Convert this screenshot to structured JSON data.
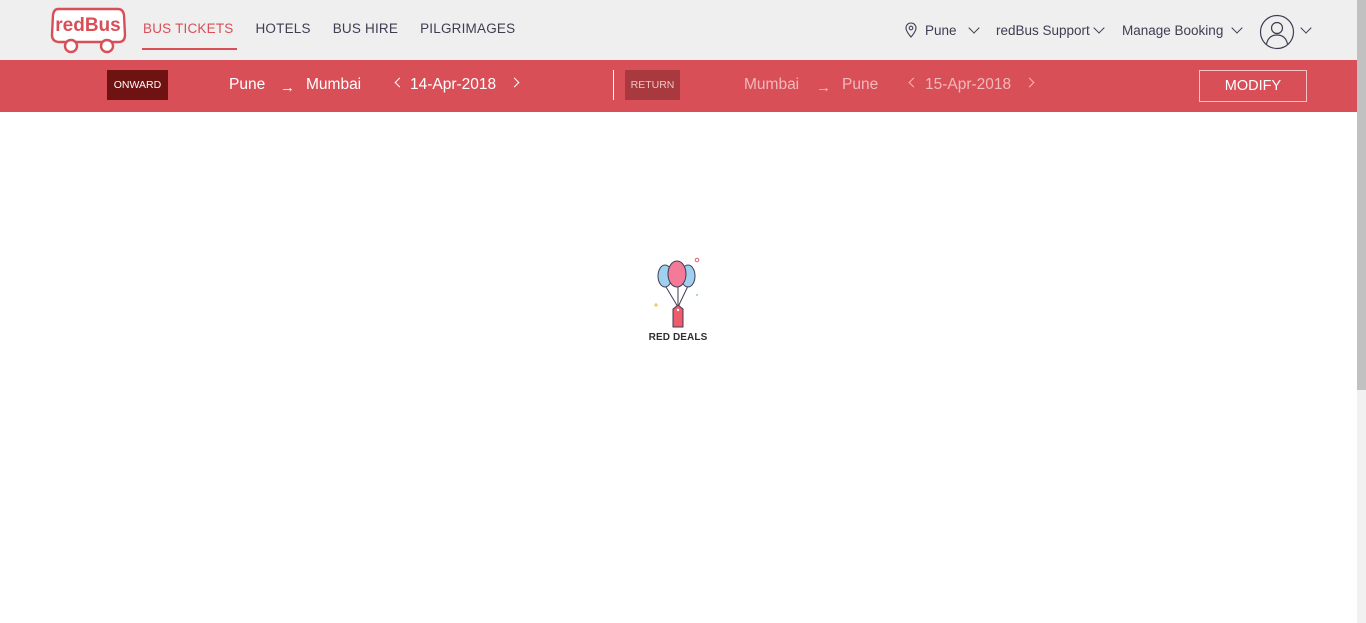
{
  "brand": {
    "logo_text": "redBus"
  },
  "nav": {
    "items": [
      {
        "label": "BUS TICKETS",
        "active": true
      },
      {
        "label": "HOTELS",
        "active": false
      },
      {
        "label": "BUS HIRE",
        "active": false
      },
      {
        "label": "PILGRIMAGES",
        "active": false
      }
    ]
  },
  "header_right": {
    "city": "Pune",
    "support": "redBus Support",
    "manage_booking": "Manage Booking"
  },
  "search": {
    "onward": {
      "badge": "ONWARD",
      "from": "Pune",
      "to": "Mumbai",
      "date": "14-Apr-2018"
    },
    "return": {
      "badge": "RETURN",
      "from": "Mumbai",
      "to": "Pune",
      "date": "15-Apr-2018"
    },
    "arrow": "→",
    "modify_label": "MODIFY"
  },
  "promo": {
    "label": "RED DEALS"
  },
  "colors": {
    "accent": "#d84f57",
    "onward_badge": "#6f1212",
    "header_bg": "#efefef"
  },
  "icons": [
    "redbus-logo",
    "location-pin-icon",
    "chevron-down-icon",
    "user-avatar-icon",
    "balloons-icon"
  ]
}
